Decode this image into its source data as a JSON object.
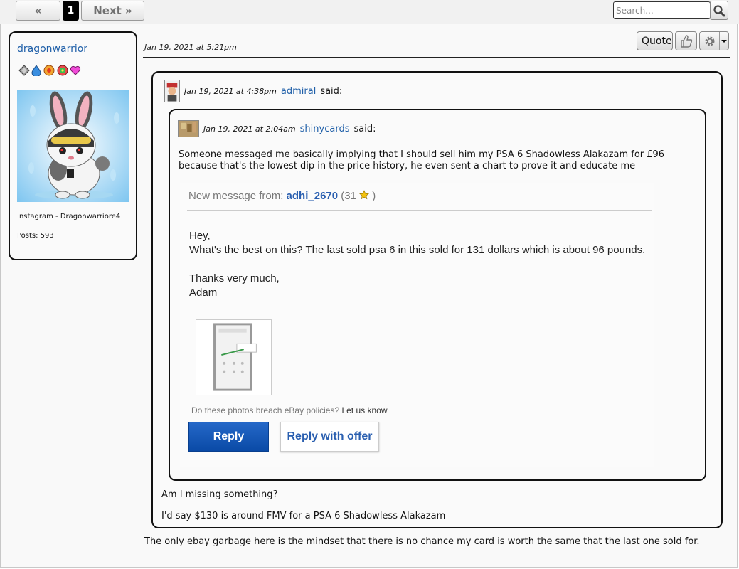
{
  "pagination": {
    "prev": "« Prev",
    "current": "1",
    "next": "Next »"
  },
  "search": {
    "placeholder": "Search..."
  },
  "profile": {
    "username": "dragonwarrior",
    "instagram": "Instagram - Dragonwarriore4",
    "posts": "Posts: 593"
  },
  "post": {
    "date": "Jan 19, 2021 at 5:21pm",
    "quote_label": "Quote",
    "body": "The only ebay garbage here is the mindset that there is no chance my card is worth the same that the last one sold for."
  },
  "outer_quote": {
    "date": "Jan 19, 2021 at 4:38pm",
    "user": "admiral",
    "said": "said:",
    "line1": "Am I missing something?",
    "line2": "I'd say $130 is around FMV for a PSA 6 Shadowless Alakazam"
  },
  "inner_quote": {
    "date": "Jan 19, 2021 at 2:04am",
    "user": "shinycards",
    "said": "said:",
    "text": "Someone messaged me basically implying that I should sell him my PSA 6 Shadowless Alakazam for £96 because that's the lowest dip in the price history, he even sent a chart to prove it and educate me"
  },
  "ebay_message": {
    "header_prefix": "New message from:",
    "sender": "adhi_2670",
    "rating_open": "(31",
    "rating_close": ")",
    "greeting": "Hey,",
    "body": "What's the best on this? The last sold psa 6 in this sold for 131 dollars which is about 96 pounds.",
    "thanks": "Thanks very much,",
    "name": "Adam",
    "policy_text": "Do these photos breach eBay policies?",
    "policy_link": "Let us know",
    "reply_label": "Reply",
    "offer_label": "Reply with offer"
  },
  "colors": {
    "link": "#1f5fa8",
    "ebay_blue": "#0a4aa6"
  }
}
